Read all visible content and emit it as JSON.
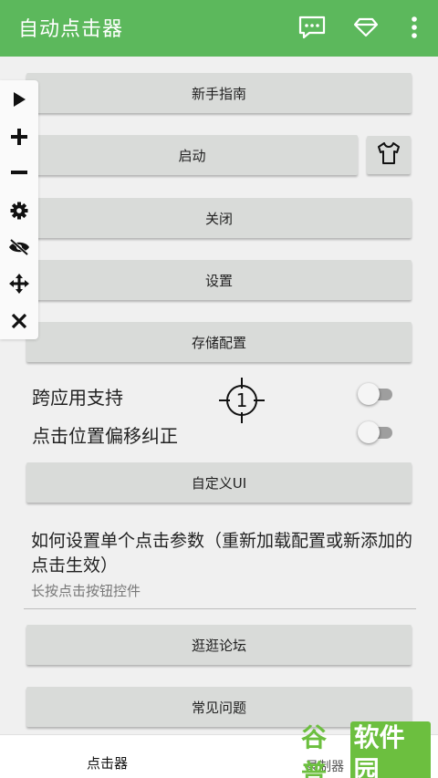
{
  "appbar": {
    "title": "自动点击器",
    "icons": [
      "chat-icon",
      "diamond-icon",
      "more-vert-icon"
    ],
    "color": "#5cb85c"
  },
  "floatbar": {
    "icons": [
      "play-icon",
      "plus-icon",
      "minus-icon",
      "gear-icon",
      "eye-off-icon",
      "move-icon",
      "close-icon"
    ]
  },
  "buttons": {
    "guide": "新手指南",
    "start": "启动",
    "close": "关闭",
    "settings": "设置",
    "save_config": "存储配置",
    "custom_ui": "自定义UI",
    "forum": "逛逛论坛",
    "faq": "常见问题"
  },
  "target_marker": {
    "label": "1"
  },
  "options": {
    "cross_app": {
      "label": "跨应用支持",
      "enabled": false
    },
    "offset_correction": {
      "label": "点击位置偏移纠正",
      "enabled": false
    }
  },
  "help": {
    "title": "如何设置单个点击参数（重新加载配置或新添加的点击生效）",
    "subtitle": "长按点击按钮控件"
  },
  "bottom_nav": {
    "tab1": "点击器",
    "tab2_partial": "录制器"
  },
  "watermark": {
    "part1": "谷普",
    "part2": "软件园"
  }
}
